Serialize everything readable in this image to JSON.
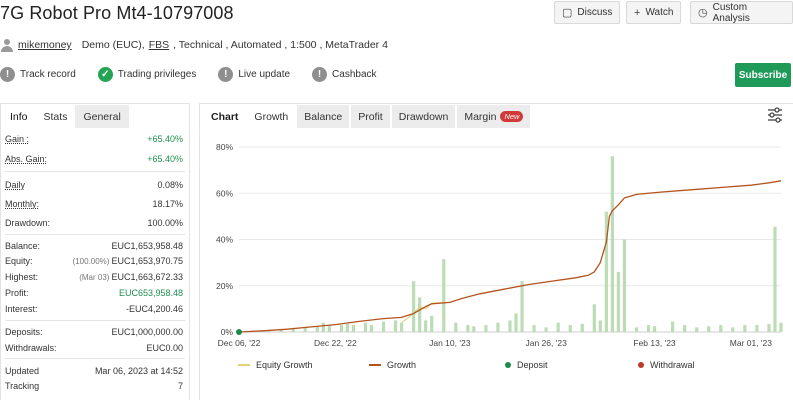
{
  "title": "7G Robot Pro Mt4-10797008",
  "header_buttons": {
    "discuss": "Discuss",
    "watch": "Watch",
    "custom_analysis": "Custom Analysis"
  },
  "meta": {
    "user": "mikemoney",
    "account_type": "Demo (EUC),",
    "broker": "FBS",
    "details": ", Technical , Automated , 1:500 , MetaTrader 4"
  },
  "status": [
    {
      "label": "Track record",
      "state": "gray",
      "icon": "exclamation-icon"
    },
    {
      "label": "Trading privileges",
      "state": "green",
      "icon": "check-icon"
    },
    {
      "label": "Live update",
      "state": "gray",
      "icon": "exclamation-icon"
    },
    {
      "label": "Cashback",
      "state": "gray",
      "icon": "exclamation-icon"
    }
  ],
  "subscribe_label": "Subscribe",
  "left_tabs": [
    "Info",
    "Stats",
    "General"
  ],
  "stats": {
    "gain": {
      "label": "Gain :",
      "value": "+65.40%"
    },
    "abs_gain": {
      "label": "Abs. Gain:",
      "value": "+65.40%"
    },
    "daily": {
      "label": "Daily",
      "value": "0.08%"
    },
    "monthly": {
      "label": "Monthly:",
      "value": "18.17%"
    },
    "drawdown": {
      "label": "Drawdown:",
      "value": "100.00%"
    },
    "balance": {
      "label": "Balance:",
      "value": "EUC1,653,958.48"
    },
    "equity": {
      "label": "Equity:",
      "note": "(100.00%)",
      "value": "EUC1,653,970.75"
    },
    "highest": {
      "label": "Highest:",
      "note": "(Mar 03)",
      "value": "EUC1,663,672.33"
    },
    "profit": {
      "label": "Profit:",
      "value": "EUC653,958.48"
    },
    "interest": {
      "label": "Interest:",
      "value": "-EUC4,200.46"
    },
    "deposits": {
      "label": "Deposits:",
      "value": "EUC1,000,000.00"
    },
    "withdrawals": {
      "label": "Withdrawals:",
      "value": "EUC0.00"
    },
    "updated": {
      "label": "Updated",
      "value": "Mar 06, 2023 at 14:52"
    },
    "tracking": {
      "label": "Tracking",
      "value": "7"
    }
  },
  "chart_tabs": [
    "Chart",
    "Growth",
    "Balance",
    "Profit",
    "Drawdown",
    "Margin"
  ],
  "new_badge": "New",
  "colors": {
    "growth": "#b5531f",
    "equity_growth": "#e3d07a",
    "bars": "#bcdcb5",
    "deposit": "#1f8a4c",
    "withdrawal": "#c0392b",
    "subscribe": "#1f9a59"
  },
  "chart_data": {
    "type": "line",
    "ylim": [
      0,
      80
    ],
    "yticks": [
      "0%",
      "20%",
      "40%",
      "60%",
      "80%"
    ],
    "xticks": [
      "Dec 06, '22",
      "Dec 22, '22",
      "Jan 10, '23",
      "Jan 26, '23",
      "Feb 13, '23",
      "Mar 01, '23"
    ],
    "xtick_days": [
      0,
      16,
      35,
      51,
      69,
      85
    ],
    "x_range_days": [
      0,
      90
    ],
    "series": [
      {
        "name": "Growth",
        "points": [
          [
            0,
            0
          ],
          [
            4,
            0.5
          ],
          [
            8,
            1.2
          ],
          [
            12,
            2.2
          ],
          [
            16,
            3.2
          ],
          [
            20,
            4.6
          ],
          [
            24,
            5.8
          ],
          [
            27,
            6.3
          ],
          [
            29,
            8
          ],
          [
            30,
            9.5
          ],
          [
            31,
            11
          ],
          [
            32,
            12.2
          ],
          [
            35,
            12.8
          ],
          [
            37,
            14.5
          ],
          [
            40,
            16.5
          ],
          [
            44,
            18.5
          ],
          [
            48,
            20.5
          ],
          [
            52,
            22
          ],
          [
            56,
            23.5
          ],
          [
            58,
            24.5
          ],
          [
            59,
            26
          ],
          [
            60,
            30
          ],
          [
            61,
            39
          ],
          [
            61.5,
            50
          ],
          [
            62,
            52.5
          ],
          [
            63,
            55
          ],
          [
            64,
            58
          ],
          [
            66,
            59.5
          ],
          [
            70,
            60.5
          ],
          [
            75,
            61.5
          ],
          [
            80,
            62.5
          ],
          [
            85,
            63.5
          ],
          [
            88,
            64.5
          ],
          [
            90,
            65.4
          ]
        ]
      },
      {
        "name": "Equity Growth",
        "points": [
          [
            27,
            4
          ],
          [
            29,
            8
          ],
          [
            30,
            11
          ],
          [
            31,
            10
          ],
          [
            32,
            12.5
          ],
          [
            35,
            12.8
          ]
        ]
      }
    ],
    "bars_name": "Daily gain bars",
    "bars": [
      [
        3,
        0.5
      ],
      [
        5,
        0.8
      ],
      [
        7,
        1
      ],
      [
        9,
        1.5
      ],
      [
        11,
        2
      ],
      [
        13,
        2.5
      ],
      [
        14,
        4
      ],
      [
        15,
        3
      ],
      [
        17,
        3
      ],
      [
        18,
        3.5
      ],
      [
        19,
        3
      ],
      [
        21,
        4
      ],
      [
        22,
        3
      ],
      [
        24,
        4.5
      ],
      [
        26,
        5
      ],
      [
        27,
        4
      ],
      [
        29,
        22
      ],
      [
        30,
        15
      ],
      [
        31,
        5
      ],
      [
        32,
        7
      ],
      [
        34,
        31.5
      ],
      [
        36,
        4
      ],
      [
        38,
        3
      ],
      [
        39,
        2.5
      ],
      [
        41,
        3
      ],
      [
        43,
        4
      ],
      [
        45,
        5
      ],
      [
        46,
        8
      ],
      [
        47,
        22
      ],
      [
        49,
        3
      ],
      [
        51,
        2
      ],
      [
        53,
        4
      ],
      [
        55,
        3
      ],
      [
        57,
        3.5
      ],
      [
        59,
        12
      ],
      [
        60,
        5
      ],
      [
        61,
        52
      ],
      [
        62,
        76
      ],
      [
        63,
        26
      ],
      [
        64,
        40
      ],
      [
        66,
        2
      ],
      [
        68,
        3
      ],
      [
        69,
        2.5
      ],
      [
        72,
        4.5
      ],
      [
        74,
        3
      ],
      [
        76,
        2
      ],
      [
        78,
        2.5
      ],
      [
        80,
        3
      ],
      [
        82,
        2
      ],
      [
        84,
        3
      ],
      [
        86,
        3
      ],
      [
        88,
        3.5
      ],
      [
        89,
        45.5
      ],
      [
        90,
        4
      ]
    ],
    "deposit_points": [
      [
        0,
        0
      ]
    ],
    "legend": [
      "Equity Growth",
      "Growth",
      "Deposit",
      "Withdrawal"
    ],
    "legend_position": "bottom"
  }
}
